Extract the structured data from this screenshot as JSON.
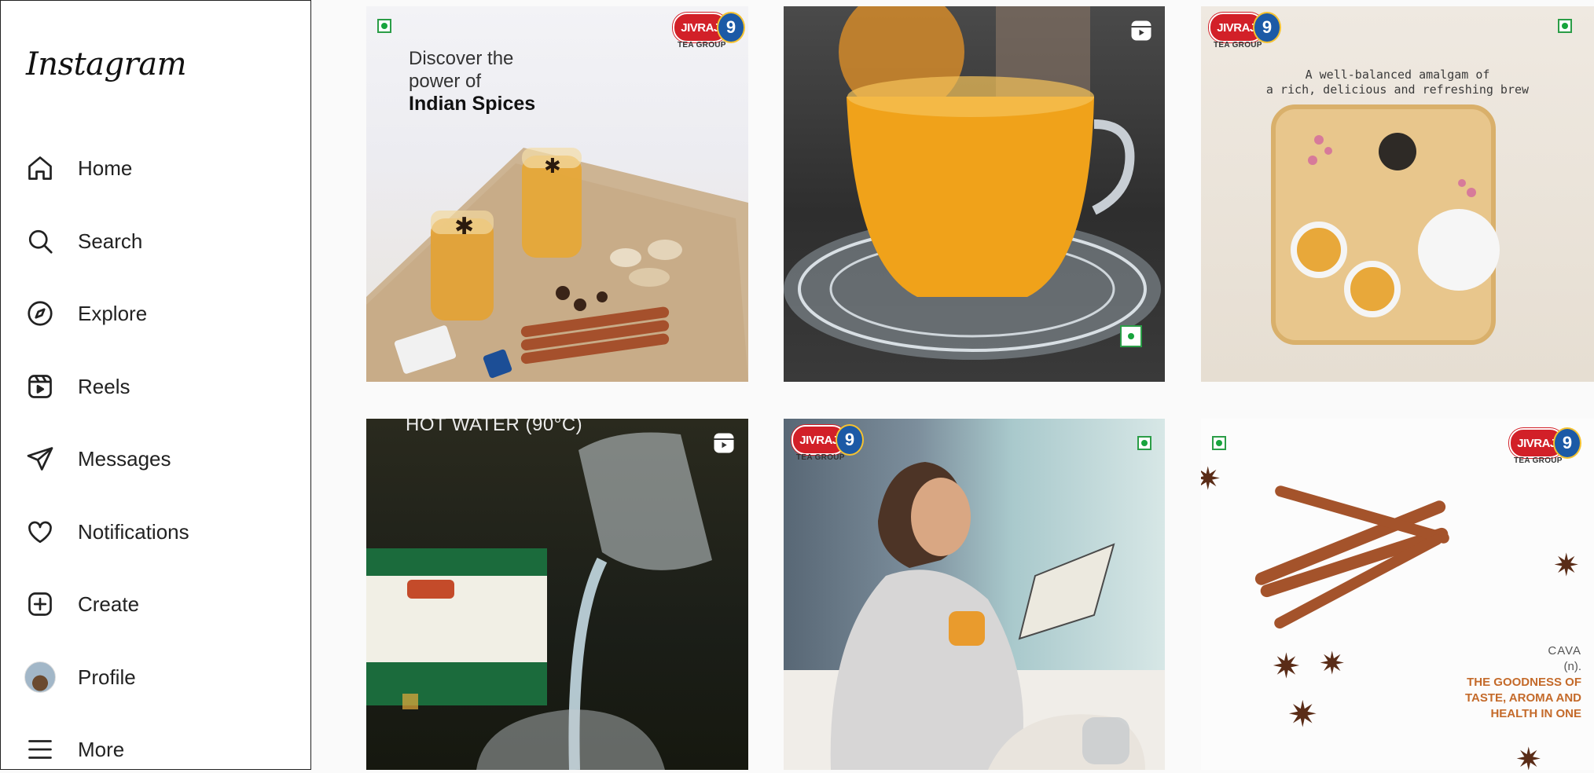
{
  "sidebar": {
    "logo": "Instagram",
    "items": [
      {
        "label": "Home",
        "icon": "home-icon"
      },
      {
        "label": "Search",
        "icon": "search-icon"
      },
      {
        "label": "Explore",
        "icon": "compass-icon"
      },
      {
        "label": "Reels",
        "icon": "reels-icon"
      },
      {
        "label": "Messages",
        "icon": "paper-plane-icon"
      },
      {
        "label": "Notifications",
        "icon": "heart-icon"
      },
      {
        "label": "Create",
        "icon": "plus-square-icon"
      },
      {
        "label": "Profile",
        "icon": "avatar"
      },
      {
        "label": "More",
        "icon": "hamburger-icon"
      }
    ]
  },
  "brand": {
    "name": "JIVRAJ",
    "number": "9",
    "tagline": "TEA GROUP"
  },
  "posts": [
    {
      "heading_lines": [
        "Discover the",
        "power of"
      ],
      "heading_bold": "Indian Spices"
    },
    {},
    {
      "caption_lines": [
        "A well-balanced amalgam of",
        "a rich, delicious and refreshing brew"
      ]
    },
    {
      "overlay": "HOT WATER (90°C)"
    },
    {},
    {
      "word": "CAVA",
      "pos": "(n).",
      "tagline_lines": [
        "THE GOODNESS OF",
        "TASTE, AROMA AND",
        "HEALTH IN ONE"
      ]
    }
  ],
  "colors": {
    "accent": "#d22028",
    "veg": "#18a43d",
    "brand_blue": "#1c5aa6"
  }
}
